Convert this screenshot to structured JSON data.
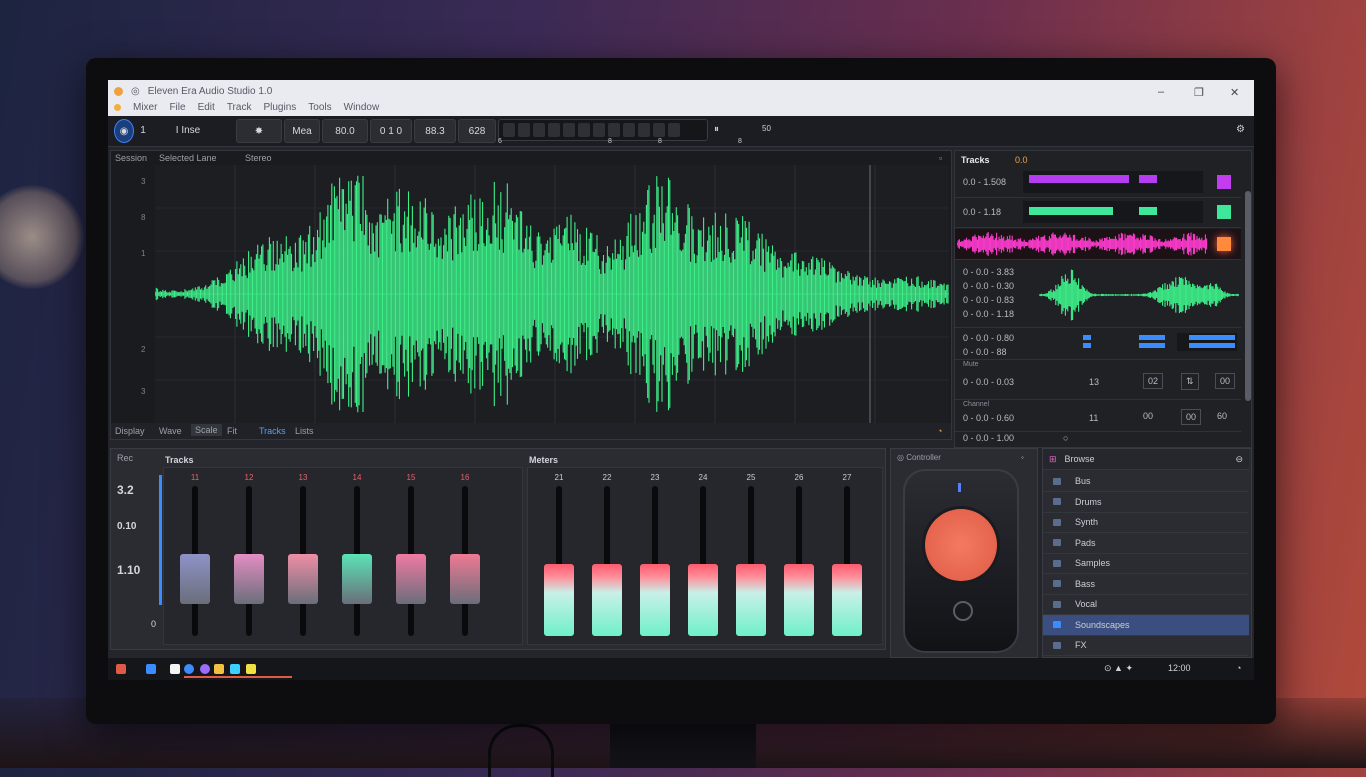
{
  "window": {
    "title": "Eleven Era  Audio Studio 1.0",
    "menu": [
      "Mixer",
      "File",
      "Edit",
      "Track",
      "Plugins",
      "Tools",
      "Window"
    ],
    "controls": [
      "–",
      "❐",
      "✕"
    ]
  },
  "toolbar": {
    "mode_num": "1",
    "tool_label": "I Inse",
    "nav_label": "Mea",
    "bpm": "80.0",
    "signature": "0 1 0",
    "position": "88.3",
    "counter": "628",
    "marker_a": "6",
    "marker_b": "8",
    "marker_c": "8",
    "marker_d": "8",
    "zoom_label": "50"
  },
  "wave_panel": {
    "title_left": "Session",
    "title_mid": "Selected Lane",
    "title_right": "Stereo",
    "ruler": [
      "3",
      "8",
      "1",
      "2",
      "3",
      "3"
    ],
    "footer": [
      "Display",
      "Wave",
      "Scale",
      "Fit",
      "Tracks",
      "Lists"
    ]
  },
  "sidebar": {
    "title": "Tracks",
    "title_badge": "0.0",
    "rows": [
      {
        "label": "0.0 - 1.508"
      },
      {
        "label": "0.0 - 1.18"
      },
      {
        "label": "0 - 0.0 - 3.83"
      },
      {
        "label": "0 - 0.0 - 0.30"
      },
      {
        "label": "0 - 0.0 - 0.83"
      },
      {
        "label": "0 - 0.0 - 1.18"
      },
      {
        "label": "0 - 0.0 - 0.80"
      },
      {
        "label": "0 - 0.0 - 88"
      }
    ],
    "section_a": "Mute",
    "grid_row1": {
      "label": "0 - 0.0 - 0.03",
      "a": "13",
      "b": "02",
      "c": "00"
    },
    "section_b": "Channel",
    "grid_row2": {
      "label": "0 - 0.0 - 0.60",
      "a": "11",
      "b": "00",
      "c": "60"
    },
    "last_row": "0 - 0.0 - 1.00"
  },
  "mixer": {
    "left_side_label": "Rec",
    "levels": [
      "3.2",
      "0.10",
      "1.10"
    ],
    "group1_title": "Tracks",
    "group2_title": "Meters",
    "group1": [
      {
        "label": "11",
        "color": "#8e93c8",
        "pos": 0.55
      },
      {
        "label": "12",
        "color": "#e38ec3",
        "pos": 0.55
      },
      {
        "label": "13",
        "color": "#ee8fa6",
        "pos": 0.55
      },
      {
        "label": "14",
        "color": "#5be3b6",
        "pos": 0.55
      },
      {
        "label": "15",
        "color": "#ef7aa3",
        "pos": 0.55
      },
      {
        "label": "16",
        "color": "#ef7a93",
        "pos": 0.55
      }
    ],
    "group2": [
      {
        "label": "21",
        "level": 0.48
      },
      {
        "label": "22",
        "level": 0.48
      },
      {
        "label": "23",
        "level": 0.48
      },
      {
        "label": "24",
        "level": 0.48
      },
      {
        "label": "25",
        "level": 0.48
      },
      {
        "label": "26",
        "level": 0.48
      },
      {
        "label": "27",
        "level": 0.48
      }
    ],
    "foot_label": "0"
  },
  "jog": {
    "title": "Controller"
  },
  "browser": {
    "title": "Browse",
    "items": [
      "Bus",
      "Drums",
      "Synth",
      "Pads",
      "Samples",
      "Bass",
      "Vocal",
      "Soundscapes",
      "FX"
    ],
    "selected": 7
  },
  "taskbar": {
    "clock": "12:00"
  }
}
